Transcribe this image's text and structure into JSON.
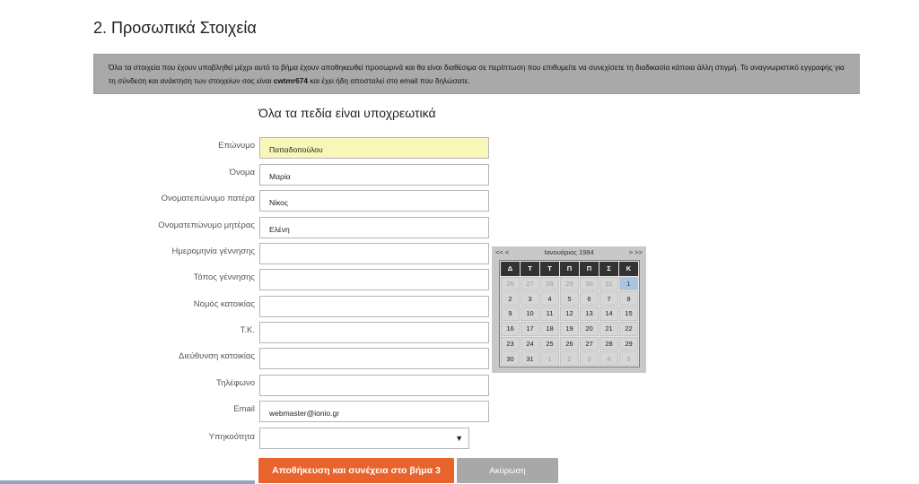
{
  "section_title": "2. Προσωπικά Στοιχεία",
  "notice": {
    "text_before": "Όλα τα στοιχεία που έχουν υποβληθεί μέχρι αυτό το βήμα έχουν αποθηκευθεί προσωρινά και θα είναι διαθέσιμα σε περίπτωση που επιθυμείτε να συνεχίσετε τη διαδικασία κάποια άλλη στιγμή. Το αναγνωριστικό εγγραφής για τη σύνδεση και ανάκτηση των στοιχείων σας είναι ",
    "code": "cwtmr674",
    "text_after": " και έχει ήδη αποσταλεί στο email που δηλώσατε."
  },
  "required_heading": "Όλα τα πεδία είναι υποχρεωτικά",
  "fields": {
    "surname": {
      "label": "Επώνυμο",
      "value": "Παπαδοπούλου"
    },
    "name": {
      "label": "Όνομα",
      "value": "Μαρία"
    },
    "father": {
      "label": "Ονοματεπώνυμο πατέρα",
      "value": "Νίκος"
    },
    "mother": {
      "label": "Ονοματεπώνυμο μητέρας",
      "value": "Ελένη"
    },
    "birthdate": {
      "label": "Ημερομηνία γέννησης",
      "value": ""
    },
    "birthplace": {
      "label": "Τόπος γέννησης",
      "value": ""
    },
    "prefecture": {
      "label": "Νομός κατοικίας",
      "value": ""
    },
    "postcode": {
      "label": "Τ.Κ.",
      "value": ""
    },
    "address": {
      "label": "Διεύθυνση κατοικίας",
      "value": ""
    },
    "phone": {
      "label": "Τηλέφωνο",
      "value": ""
    },
    "email": {
      "label": "Email",
      "value": "webmaster@ionio.gr"
    },
    "nationality": {
      "label": "Υπηκοότητα",
      "value": ""
    }
  },
  "select_arrow": "▼",
  "buttons": {
    "save": "Αποθήκευση και συνέχεια στο βήμα 3",
    "cancel": "Ακύρωση"
  },
  "calendar": {
    "prev": "<< <",
    "title": "Ιανουάριος 1984",
    "next": "> >>",
    "weekdays": [
      "Δ",
      "Τ",
      "Τ",
      "Π",
      "Π",
      "Σ",
      "Κ"
    ],
    "weeks": [
      [
        {
          "d": "26",
          "o": true
        },
        {
          "d": "27",
          "o": true
        },
        {
          "d": "28",
          "o": true
        },
        {
          "d": "29",
          "o": true
        },
        {
          "d": "30",
          "o": true
        },
        {
          "d": "31",
          "o": true
        },
        {
          "d": "1",
          "s": true
        }
      ],
      [
        {
          "d": "2"
        },
        {
          "d": "3"
        },
        {
          "d": "4"
        },
        {
          "d": "5"
        },
        {
          "d": "6"
        },
        {
          "d": "7"
        },
        {
          "d": "8"
        }
      ],
      [
        {
          "d": "9"
        },
        {
          "d": "10"
        },
        {
          "d": "11"
        },
        {
          "d": "12"
        },
        {
          "d": "13"
        },
        {
          "d": "14"
        },
        {
          "d": "15"
        }
      ],
      [
        {
          "d": "16"
        },
        {
          "d": "17"
        },
        {
          "d": "18"
        },
        {
          "d": "19"
        },
        {
          "d": "20"
        },
        {
          "d": "21"
        },
        {
          "d": "22"
        }
      ],
      [
        {
          "d": "23"
        },
        {
          "d": "24"
        },
        {
          "d": "25"
        },
        {
          "d": "26"
        },
        {
          "d": "27"
        },
        {
          "d": "28"
        },
        {
          "d": "29"
        }
      ],
      [
        {
          "d": "30"
        },
        {
          "d": "31"
        },
        {
          "d": "1",
          "o": true
        },
        {
          "d": "2",
          "o": true
        },
        {
          "d": "3",
          "o": true
        },
        {
          "d": "4",
          "o": true
        },
        {
          "d": "5",
          "o": true
        }
      ]
    ]
  },
  "colors": {
    "primary_button": "#e8642c",
    "secondary_button": "#a8a8a8",
    "highlight_field": "#f8f6b8",
    "notice_bg": "#a9a9a9"
  }
}
